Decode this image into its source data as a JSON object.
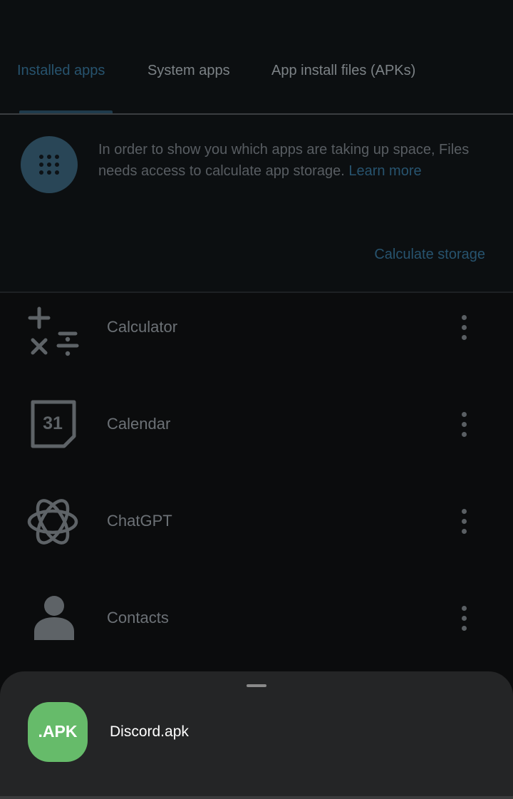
{
  "tabs": [
    {
      "label": "Installed apps",
      "active": true
    },
    {
      "label": "System apps",
      "active": false
    },
    {
      "label": "App install files (APKs)",
      "active": false
    }
  ],
  "banner": {
    "icon": "app-grid-icon",
    "text": "In order to show you which apps are taking up space, Files needs access to calculate app storage. ",
    "link_label": "Learn more",
    "action_label": "Calculate storage"
  },
  "apps": [
    {
      "name": "Calculator",
      "icon": "calculator-icon"
    },
    {
      "name": "Calendar",
      "icon": "calendar-icon",
      "icon_text": "31"
    },
    {
      "name": "ChatGPT",
      "icon": "chatgpt-icon"
    },
    {
      "name": "Contacts",
      "icon": "contacts-icon"
    }
  ],
  "bottom_sheet": {
    "file_icon_label": ".APK",
    "file_name": "Discord.apk",
    "icon_color": "#66bb6a"
  },
  "colors": {
    "accent": "#27536e",
    "background": "#0b0c0d",
    "sheet_background": "#242526"
  }
}
